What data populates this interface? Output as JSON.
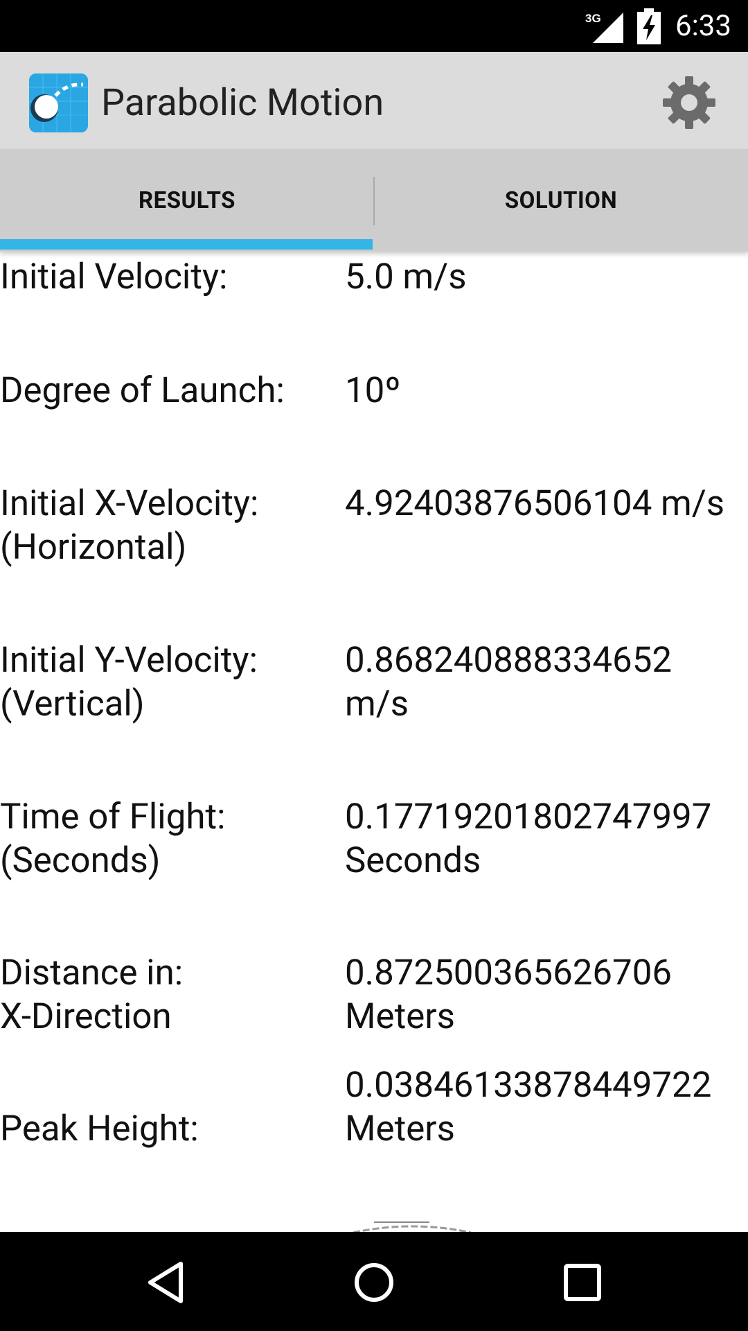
{
  "status_bar": {
    "network": "3G",
    "time": "6:33",
    "icons": [
      "signal-icon",
      "battery-charging-icon"
    ]
  },
  "action_bar": {
    "title": "Parabolic Motion",
    "icons": [
      "app-icon",
      "gear-icon"
    ]
  },
  "tabs": [
    {
      "label": "RESULTS",
      "selected": true
    },
    {
      "label": "SOLUTION",
      "selected": false
    }
  ],
  "accent_color": "#33b5e5",
  "results": [
    {
      "label": "Initial Velocity:",
      "value": "5.0  m/s"
    },
    {
      "label": "Degree of Launch:",
      "value": "10º"
    },
    {
      "label": "Initial X-Velocity:\n(Horizontal)",
      "value": "4.92403876506104  m/s"
    },
    {
      "label": "Initial Y-Velocity:\n(Vertical)",
      "value": "0.868240888334652\nm/s"
    },
    {
      "label": "Time of Flight:\n(Seconds)",
      "value": "0.17719201802747997\nSeconds"
    },
    {
      "label": "Distance in:\n X-Direction",
      "value": "0.872500365626706\nMeters"
    },
    {
      "label": "Peak Height:",
      "value": "0.03846133878449722\nMeters"
    }
  ],
  "nav_bar": {
    "icons": [
      "back-icon",
      "home-icon",
      "recents-icon"
    ]
  }
}
